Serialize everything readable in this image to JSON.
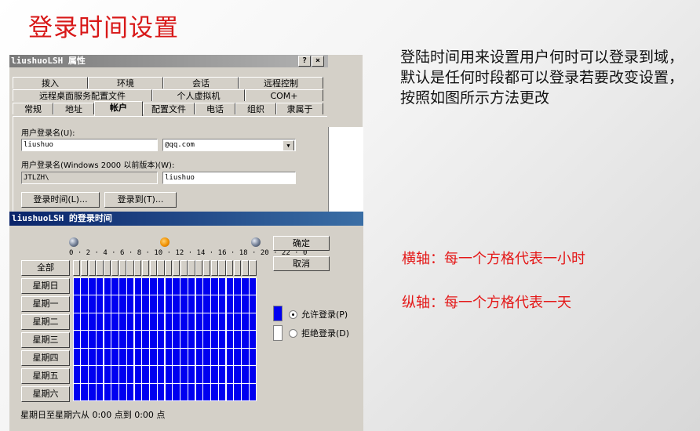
{
  "slide": {
    "title": "登录时间设置",
    "description": "登陆时间用来设置用户何时可以登录到域，默认是任何时段都可以登录若要改变设置，按照如图所示方法更改",
    "x_axis_note": "横轴：每一个方格代表一小时",
    "y_axis_note": "纵轴：每一个方格代表一天"
  },
  "properties_dialog": {
    "title": "liushuoLSH 属性",
    "help_btn": "?",
    "close_btn": "×",
    "tabs_row1": [
      "拨入",
      "环境",
      "会话",
      "远程控制"
    ],
    "tabs_row2": [
      "远程桌面服务配置文件",
      "个人虚拟机",
      "COM+"
    ],
    "tabs_row3": [
      "常规",
      "地址",
      "帐户",
      "配置文件",
      "电话",
      "组织",
      "隶属于"
    ],
    "active_tab": "帐户",
    "logon_name_label": "用户登录名(U):",
    "logon_name_value": "liushuo",
    "domain_value": "@qq.com",
    "pre2000_label": "用户登录名(Windows 2000 以前版本)(W):",
    "pre2000_domain": "JTLZH\\",
    "pre2000_value": "liushuo",
    "logon_hours_button": "登录时间(L)...",
    "logon_to_button": "登录到(T)..."
  },
  "hours_dialog": {
    "title": "liushuoLSH 的登录时间",
    "axis_labels": "0 · 2 · 4 · 6 · 8 · 10 · 12 · 14 · 16 · 18 · 20 · 22 · 0",
    "all_button": "全部",
    "days": [
      "星期日",
      "星期一",
      "星期二",
      "星期三",
      "星期四",
      "星期五",
      "星期六"
    ],
    "ok_button": "确定",
    "cancel_button": "取消",
    "allow_label": "允许登录(P)",
    "deny_label": "拒绝登录(D)",
    "allow_color": "#0000f0",
    "status": "星期日至星期六从 0:00 点到 0:00 点"
  }
}
